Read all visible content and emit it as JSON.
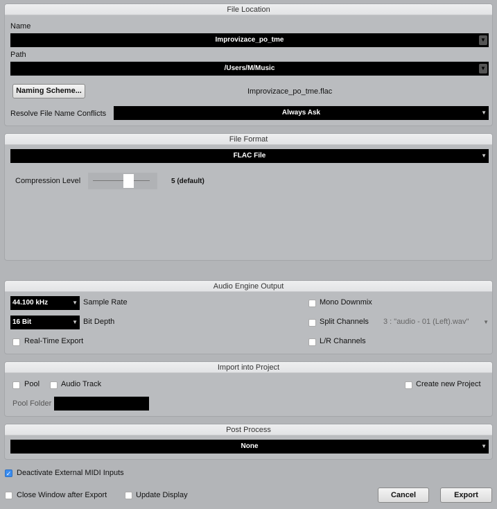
{
  "file_location": {
    "title": "File Location",
    "name_label": "Name",
    "name_value": "Improvizace_po_tme",
    "path_label": "Path",
    "path_value": "/Users/M/Music",
    "naming_scheme_button": "Naming Scheme...",
    "filename_preview": "Improvizace_po_tme.flac",
    "resolve_label": "Resolve File Name Conflicts",
    "resolve_value": "Always Ask"
  },
  "file_format": {
    "title": "File Format",
    "format_value": "FLAC File",
    "compression_label": "Compression Level",
    "compression_value": "5 (default)",
    "compression_level": 5
  },
  "audio_engine": {
    "title": "Audio Engine Output",
    "sample_rate_value": "44.100 kHz",
    "sample_rate_label": "Sample Rate",
    "bit_depth_value": "16 Bit",
    "bit_depth_label": "Bit Depth",
    "realtime_label": "Real-Time Export",
    "realtime_checked": false,
    "mono_label": "Mono Downmix",
    "mono_checked": false,
    "split_label": "Split Channels",
    "split_checked": false,
    "split_value": "3 : \"audio - 01 (Left).wav\"",
    "lr_label": "L/R Channels",
    "lr_checked": false
  },
  "import": {
    "title": "Import into Project",
    "pool_label": "Pool",
    "audio_track_label": "Audio Track",
    "create_project_label": "Create new Project",
    "pool_folder_label": "Pool Folder",
    "pool_folder_value": ""
  },
  "post_process": {
    "title": "Post Process",
    "value": "None"
  },
  "footer": {
    "deactivate_midi_label": "Deactivate External MIDI Inputs",
    "deactivate_midi_checked": true,
    "close_window_label": "Close Window after Export",
    "update_display_label": "Update Display",
    "cancel": "Cancel",
    "export": "Export"
  },
  "colors": {
    "accent": "#3b8df0",
    "field_bg": "#000000",
    "panel_bg": "#babcbf"
  }
}
